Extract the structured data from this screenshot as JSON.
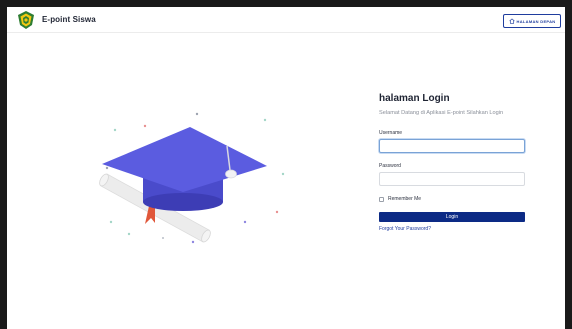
{
  "app": {
    "name": "E-point Siswa",
    "logo_icon": "school-emblem-icon"
  },
  "header": {
    "home_button_label": "HALAMAN DEPAN",
    "home_icon": "home-icon"
  },
  "illustration": {
    "icon": "graduation-cap-diploma-icon"
  },
  "login": {
    "title": "halaman Login",
    "subtitle": "Selamat Datang di Aplikasi E-point Silahkan Login",
    "username_label": "Username",
    "username_value": "",
    "password_label": "Password",
    "password_value": "",
    "remember_label": "Remember Me",
    "remember_checked": false,
    "submit_label": "Login",
    "forgot_label": "Forgot Your Password?"
  },
  "colors": {
    "accent": "#0c2a85",
    "cap": "#5b5ce0",
    "cap_dark": "#4141b8",
    "tassel": "#e0573a",
    "logo_green": "#2e7d32",
    "logo_yellow": "#f2c811"
  }
}
